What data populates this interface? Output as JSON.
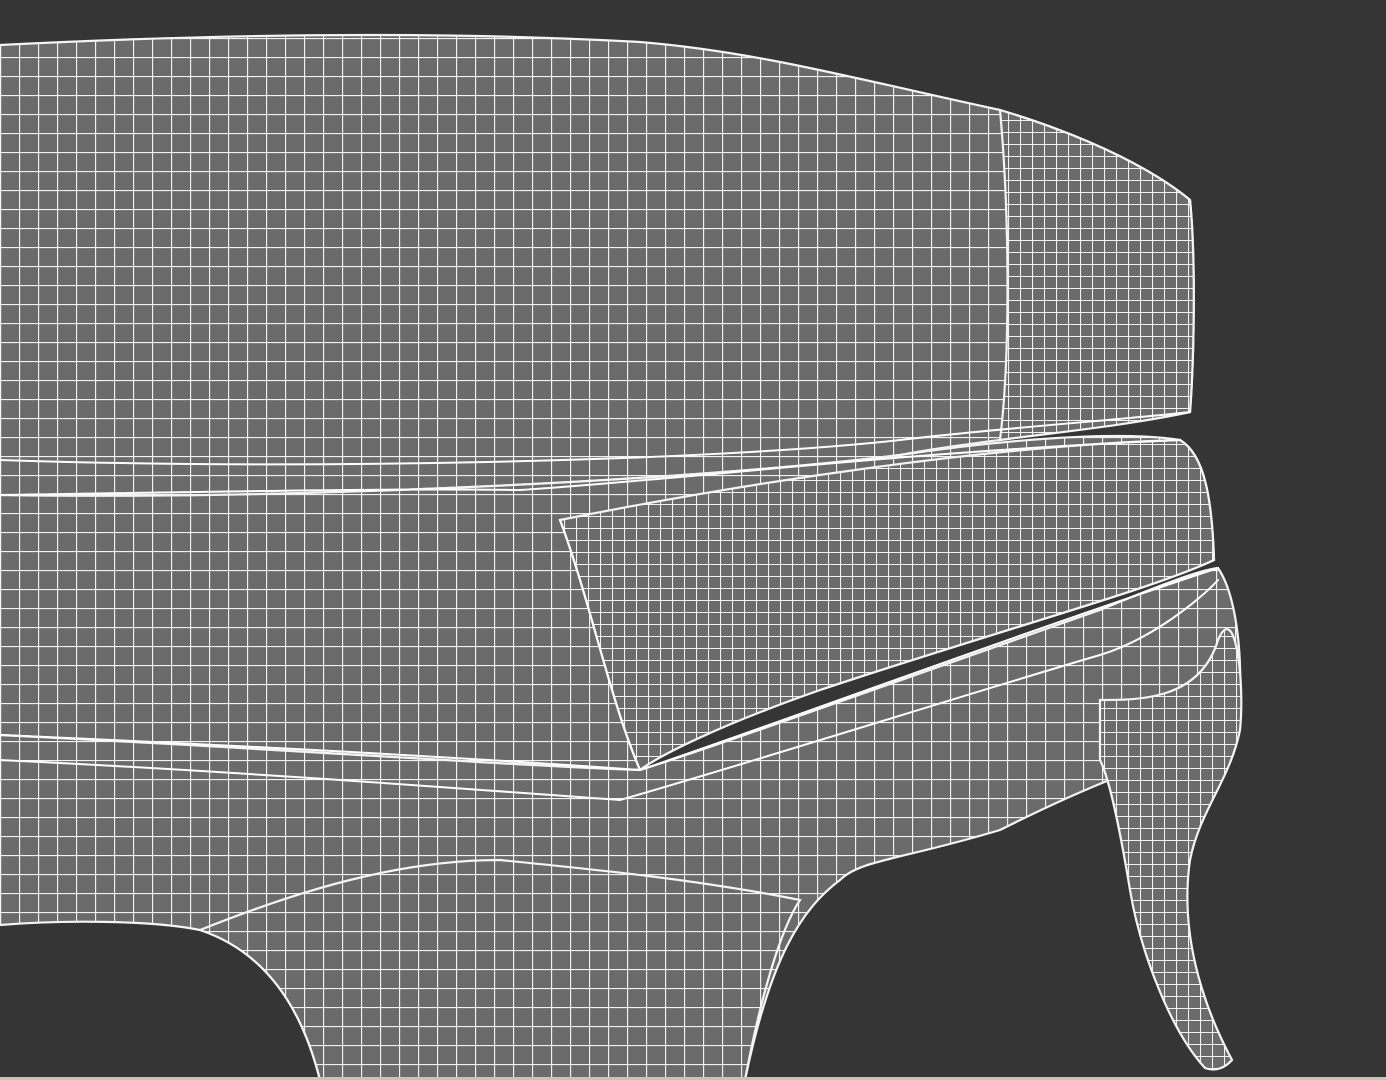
{
  "viewport": {
    "mode": "wireframe",
    "object": "sofa-mesh",
    "shading": "edged-faces"
  },
  "colors": {
    "background": "#353535",
    "mesh_fill": "#6b6b6b",
    "wire": "#f4f4f4",
    "status_strip": "#c9c7a2"
  }
}
